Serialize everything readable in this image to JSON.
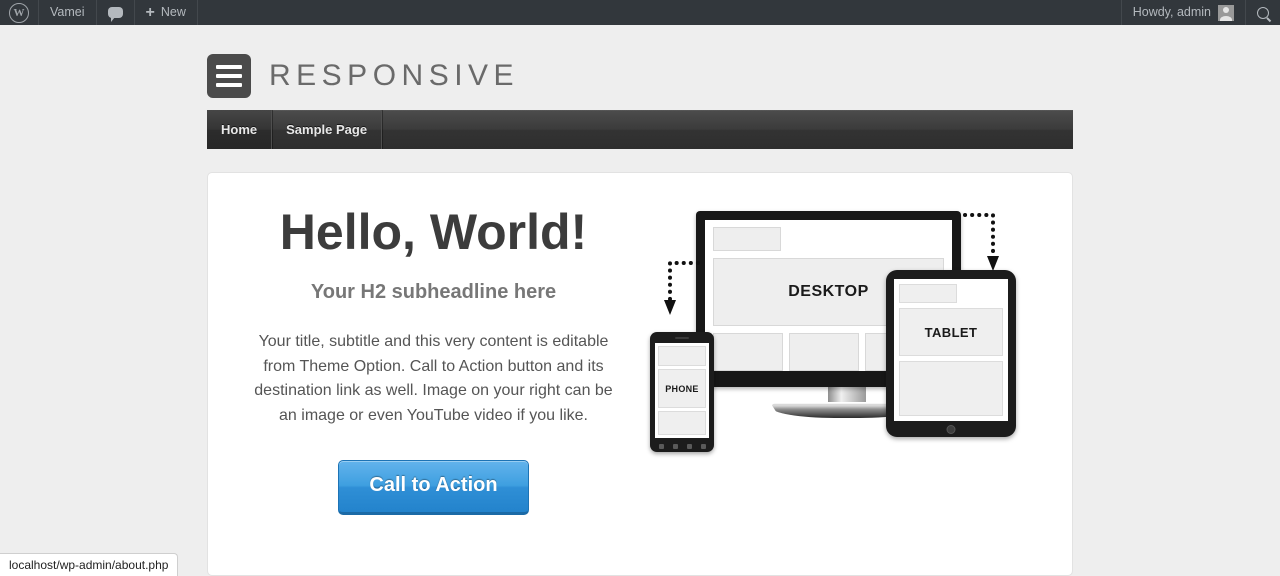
{
  "adminbar": {
    "wp_logo": "wordpress-logo",
    "site_name": "Vamei",
    "comments_icon": "comment-bubble-icon",
    "new_label": "New",
    "howdy": "Howdy, admin",
    "search_icon": "search-icon"
  },
  "header": {
    "logo_icon": "hamburger-logo-icon",
    "site_title": "RESPONSIVE"
  },
  "nav": {
    "items": [
      {
        "label": "Home",
        "current": true
      },
      {
        "label": "Sample Page",
        "current": false
      }
    ]
  },
  "hero": {
    "headline": "Hello, World!",
    "subheadline": "Your H2 subheadline here",
    "paragraph": "Your title, subtitle and this very content is editable from Theme Option. Call to Action button and its destination link as well. Image on your right can be an image or even YouTube video if you like.",
    "button_label": "Call to Action",
    "button_color": "#2f8fd6"
  },
  "illustration": {
    "desktop_label": "DESKTOP",
    "tablet_label": "TABLET",
    "phone_label": "PHONE"
  },
  "statusbar": {
    "url": "localhost/wp-admin/about.php"
  }
}
